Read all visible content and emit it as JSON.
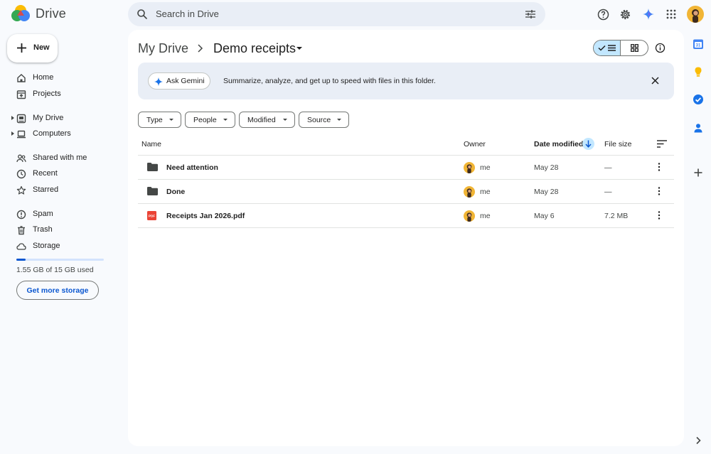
{
  "app": {
    "name": "Drive"
  },
  "search": {
    "placeholder": "Search in Drive"
  },
  "sidebar": {
    "new_label": "New",
    "items": [
      {
        "label": "Home"
      },
      {
        "label": "Projects"
      },
      {
        "label": "My Drive"
      },
      {
        "label": "Computers"
      },
      {
        "label": "Shared with me"
      },
      {
        "label": "Recent"
      },
      {
        "label": "Starred"
      },
      {
        "label": "Spam"
      },
      {
        "label": "Trash"
      },
      {
        "label": "Storage"
      }
    ],
    "storage": {
      "used_text": "1.55 GB of 15 GB used",
      "used_fraction": 0.103,
      "button_label": "Get more storage"
    }
  },
  "breadcrumb": {
    "parent": "My Drive",
    "current": "Demo receipts"
  },
  "gemini": {
    "button_label": "Ask Gemini",
    "message": "Summarize, analyze, and get up to speed with files in this folder."
  },
  "filters": [
    "Type",
    "People",
    "Modified",
    "Source"
  ],
  "table": {
    "headers": {
      "name": "Name",
      "owner": "Owner",
      "date": "Date modified",
      "size": "File size"
    },
    "rows": [
      {
        "type": "folder",
        "name": "Need attention",
        "owner": "me",
        "date": "May 28",
        "size": "—"
      },
      {
        "type": "folder",
        "name": "Done",
        "owner": "me",
        "date": "May 28",
        "size": "—"
      },
      {
        "type": "pdf",
        "name": "Receipts Jan 2026.pdf",
        "owner": "me",
        "date": "May 6",
        "size": "7.2 MB",
        "pdf_badge": "PDF"
      }
    ]
  },
  "rail": {
    "calendar_day": "31"
  },
  "colors": {
    "accent": "#0b57d0",
    "selected": "#c2e7ff",
    "background": "#f8fafd",
    "pdf": "#ea4335"
  }
}
